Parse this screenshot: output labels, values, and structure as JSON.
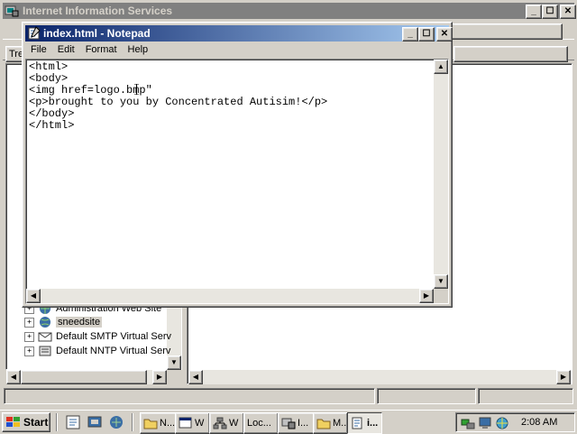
{
  "iis_window": {
    "title": "Internet Information Services",
    "tab_stub": "Tre",
    "tree": [
      {
        "label": "Administration Web Site",
        "icon": "web-site-icon",
        "partial": true
      },
      {
        "label": "sneedsite",
        "icon": "web-site-icon",
        "selected": true
      },
      {
        "label": "Default SMTP Virtual Serv",
        "icon": "smtp-icon"
      },
      {
        "label": "Default NNTP Virtual Serv",
        "icon": "nntp-icon"
      }
    ]
  },
  "notepad": {
    "title": "index.html - Notepad",
    "menu": [
      "File",
      "Edit",
      "Format",
      "Help"
    ],
    "lines": [
      "<html>",
      "<body>",
      "<img href=logo.bmp\"",
      "<p>brought to you by Concentrated Autisim!</p>",
      "</body>",
      "</html>"
    ]
  },
  "taskbar": {
    "start_label": "Start",
    "buttons": [
      {
        "label": "N...",
        "icon": "folder-icon"
      },
      {
        "label": "W",
        "icon": "window-icon"
      },
      {
        "label": "W",
        "icon": "network-icon"
      },
      {
        "label": "Loc...",
        "icon": ""
      },
      {
        "label": "I...",
        "icon": "iis-icon"
      },
      {
        "label": "M...",
        "icon": "folder-icon"
      },
      {
        "label": "i...",
        "icon": "notepad-icon",
        "active": true
      }
    ],
    "clock": "2:08 AM"
  }
}
